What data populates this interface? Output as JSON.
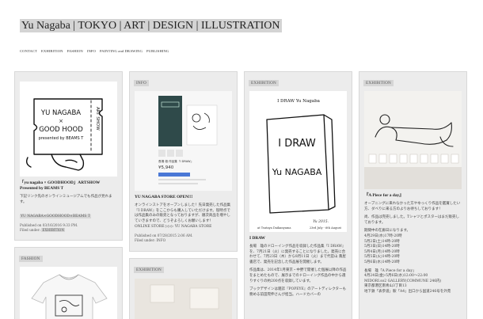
{
  "site": {
    "title": "Yu Nagaba | TOKYO | ART | DESIGN | ILLUSTRATION"
  },
  "nav": [
    "CONTACT",
    "EXHIBITION",
    "FASHION",
    "INFO",
    "PAINTING and DRAWING",
    "PUBLISHING"
  ],
  "posts": {
    "goodhood": {
      "title": "「yu nagaba × GOODHOOD」ARTSHOW Presented by BEAMS T",
      "text": "下記リンク先のオンラインミュージアムでも作品が見れます。",
      "link": "YU NAGABA×GOODHOOD×BEAMS T",
      "published": "Published on 03/16/2016 9:33 PM.",
      "filed_label": "Filed under:",
      "filed": "EXHIBITION",
      "ticket": {
        "line1": "YU NAGABA",
        "line2": "×",
        "line3": "GOOD HOOD",
        "line4": "presented by BEAMS T",
        "side": "ART SHOW"
      }
    },
    "fashion": {
      "category": "FASHION"
    },
    "store": {
      "category": "INFO",
      "title": "YU NAGABA STORE OPEN!!!",
      "text": "オンラインストアをオープンしました！先日発売した作品集『I DRAW』をここからも購入していただけます。现時点では作品集のみの販売となっておりますが、順次商品を増やしていきますので、どうぞよろしくお願いします！",
      "online": "ONLINE STORE ▷▷▷ YU NAGABA STORE",
      "published": "Published on 07/28/2015 2:06 AM.",
      "filed_label": "Filed under:",
      "filed": "INFO",
      "price": "¥5,940",
      "product": "長場 雄 作品集『I DRAW』"
    },
    "exhibition2": {
      "category": "EXHIBITION"
    },
    "idraw": {
      "category": "EXHIBITION",
      "poster_head": "I DRAW   Yu Nagaba",
      "poster_title1": "I DRAW",
      "poster_title2": "Yu NAGABA",
      "poster_sig": "Yu 2015.",
      "poster_foot_left": "at Tsutaya Daikanyama",
      "poster_foot_right": "23rd July - 6th August",
      "title": "I DRAW",
      "text1": "長場　雄のドローイング作品を収録した作品集『I DRAW』を、7月21日（火）に発売することになりました。発売に合わせて、7月23日（木）から8月11日（火）まで代官山 蔦屋書店で、発売を記念した作品展を開催します。",
      "text2": "作品集は、2014年1月東京・中野で開催した個展以降の作品をまとめたもので、展示までのドローイング作品の中から選りすぐりの約200点を収録しています。",
      "text3": "ブックデザインは雑誌『POPEYE』のアートディレクターも務める前田晃伸さんが担当。ハードカバーの"
    },
    "piece": {
      "category": "EXHIBITION",
      "title": "『A Piece for a day』",
      "text1": "オープニングに来れなかった方やゆっくり作品を鑑賞したい方、ダベりに来る方のよりお待ちしております！",
      "text2": "尚、作品は完売しました。Tシャツとポスターはまだ販売しております。",
      "schedule_head": "期間中の在廊日になります。",
      "schedule": [
        "4月29日(水)17時-20時",
        "5月2日(土)14時-20時",
        "5月3日(日)14時-20時",
        "5月4日(月)14時-20時",
        "5月5日(火)14時-20時",
        "5月6日(水)14時-20時"
      ],
      "event1": "長場　雄「A Piece for a day」",
      "event2": "4月24日(金)-5月6日(水)12:00～22:00",
      "event3": "MIDORI.so2 GALLERY(COMMUNE 246内)",
      "event4": "東京都港区南青山3丁目13",
      "event5": "地下鉄「表参道」駅「A4」出口から国道246号を外苑"
    }
  }
}
